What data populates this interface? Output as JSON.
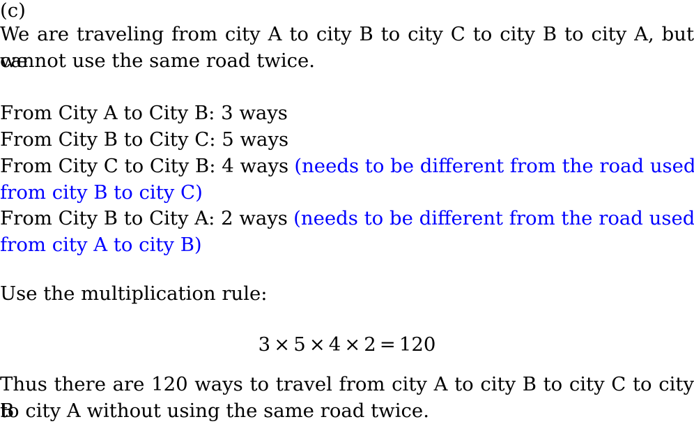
{
  "document": {
    "part_label": "(c)",
    "intro": {
      "line1": "We are traveling from city A to city B to city C to city B to city A, but we",
      "line2": "cannot use the same road twice.",
      "full": "We are traveling from city A to city B to city C to city B to city A, but we cannot use the same road twice."
    },
    "steps": [
      {
        "text": "From City A to City B: 3 ways",
        "from": "City A",
        "to": "City B",
        "ways": 3,
        "note": ""
      },
      {
        "text": "From City B to City C: 5 ways",
        "from": "City B",
        "to": "City C",
        "ways": 5,
        "note": ""
      },
      {
        "text": "From City C to City B: 4 ways",
        "from": "City C",
        "to": "City B",
        "ways": 4,
        "note": "(needs to be different from the road used from city B to city C)",
        "note_line1": "(needs to be different from the road used",
        "note_line2": "from city B to city C)"
      },
      {
        "text": "From City B to City A: 2 ways",
        "from": "City B",
        "to": "City A",
        "ways": 2,
        "note": "(needs to be different from the road used from city A to city B)",
        "note_line1": "(needs to be different from the road used",
        "note_line2": "from city A to city B)"
      }
    ],
    "rule_text": "Use the multiplication rule:",
    "equation": {
      "terms": [
        "3",
        "5",
        "4",
        "2"
      ],
      "operator": "×",
      "equals": "=",
      "result": "120",
      "full": "3 × 5 × 4 × 2 = 120"
    },
    "conclusion": {
      "line1": "Thus there are 120 ways to travel from city A to city B to city C to city B",
      "line2": "to city A without using the same road twice.",
      "full": "Thus there are 120 ways to travel from city A to city B to city C to city B to city A without using the same road twice."
    }
  },
  "colors": {
    "text": "#000000",
    "annotation": "#0000ff",
    "background": "#ffffff"
  }
}
